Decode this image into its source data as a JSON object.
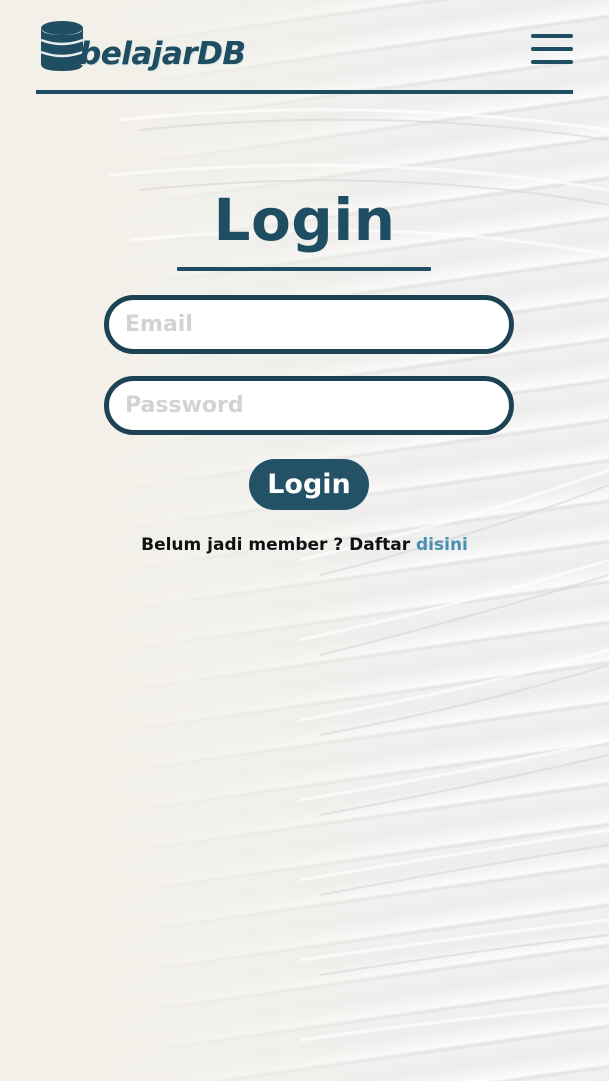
{
  "header": {
    "logo_text": "belajarDB",
    "menu_icon": "hamburger-menu-icon",
    "logo_icon": "database-icon"
  },
  "login": {
    "title": "Login",
    "email_placeholder": "Email",
    "password_placeholder": "Password",
    "button_label": "Login",
    "register_prompt": "Belum jadi member ? Daftar",
    "register_link": "disini"
  },
  "colors": {
    "primary": "#1f4e62",
    "link": "#4a8fb0",
    "background": "#f3f1ec"
  }
}
